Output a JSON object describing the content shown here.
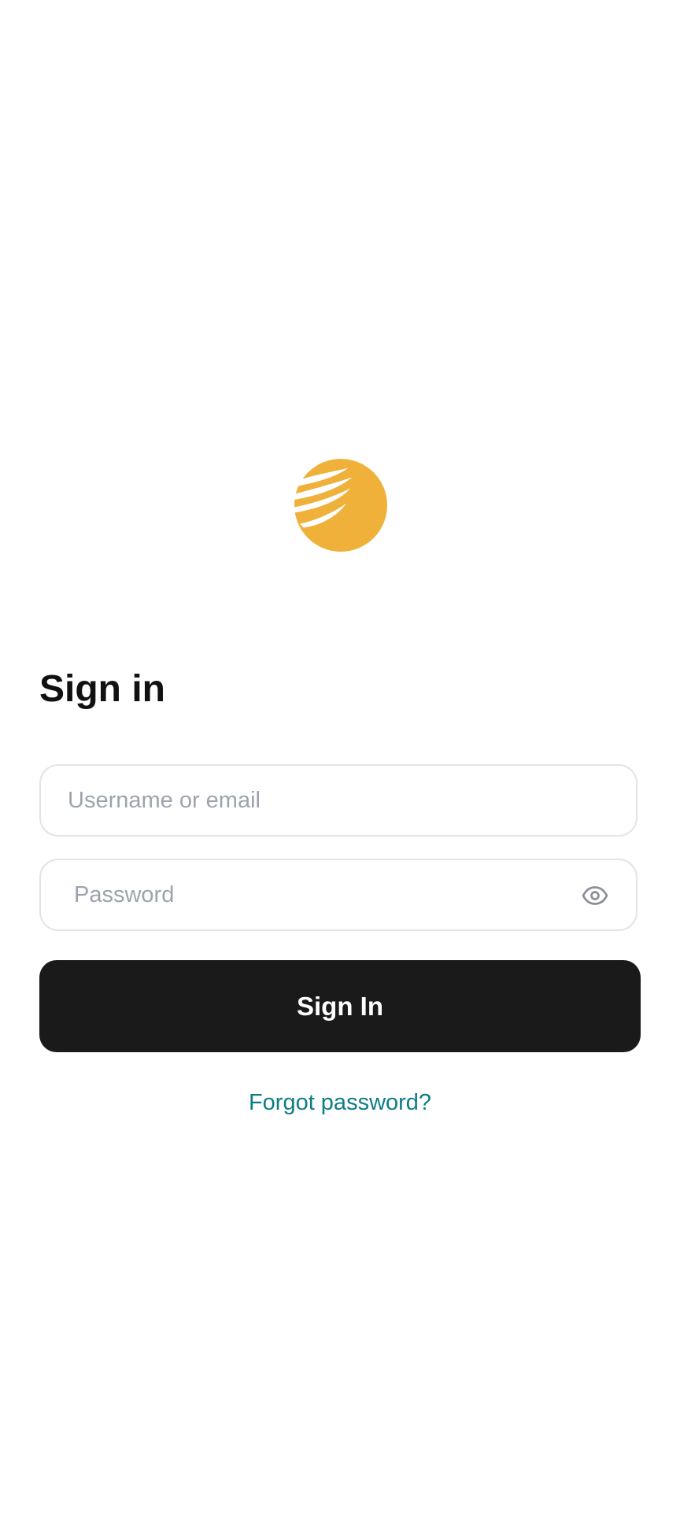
{
  "brand": {
    "logo_icon": "feather-sun-logo-icon",
    "accent_color": "#F0B13B"
  },
  "form": {
    "title": "Sign in",
    "username": {
      "placeholder": "Username or email",
      "value": ""
    },
    "password": {
      "placeholder": "Password",
      "value": "",
      "toggle_icon": "eye-icon"
    },
    "submit_label": "Sign In",
    "forgot_link": "Forgot password?"
  },
  "colors": {
    "button_bg": "#1A1A1A",
    "link": "#0E7C86",
    "placeholder": "#9CA3AF",
    "border": "#E4E4E7"
  }
}
